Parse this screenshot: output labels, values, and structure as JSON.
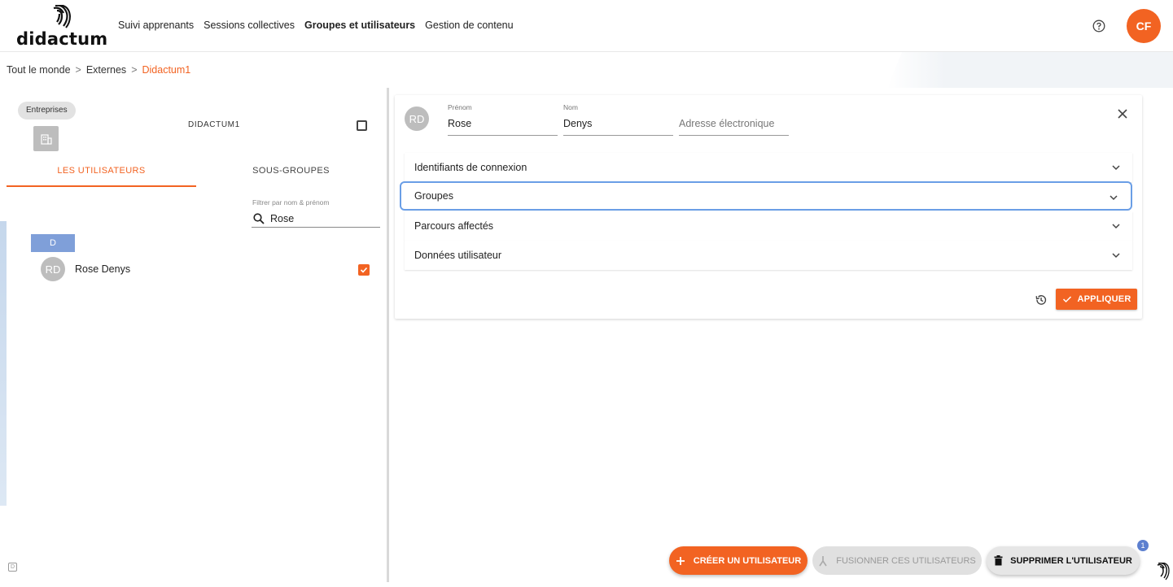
{
  "app": {
    "logo_text": "didactum",
    "nav": [
      "Suivi apprenants",
      "Sessions collectives",
      "Groupes et utilisateurs",
      "Gestion de contenu"
    ],
    "active_nav": "Groupes et utilisateurs",
    "user_initials": "CF",
    "help_icon": "help-circle-icon"
  },
  "breadcrumb": {
    "items": [
      "Tout le monde",
      "Externes"
    ],
    "separator": ">",
    "current": "Didactum1"
  },
  "left_panel": {
    "chip_label": "Entreprises",
    "company_name": "DIDACTUM1",
    "tabs": {
      "users": "LES UTILISATEURS",
      "subgroups": "SOUS-GROUPES"
    },
    "filter": {
      "label": "Filtrer par nom & prénom",
      "value": "Rose"
    },
    "letter_group": "D",
    "users": [
      {
        "initials": "RD",
        "name": "Rose Denys",
        "checked": true
      }
    ],
    "corner_badge": "D"
  },
  "user_card": {
    "initials": "RD",
    "first_name": {
      "label": "Prénom",
      "value": "Rose"
    },
    "last_name": {
      "label": "Nom",
      "value": "Denys"
    },
    "email": {
      "placeholder": "Adresse électronique",
      "value": ""
    },
    "sections": [
      "Identifiants de connexion",
      "Groupes",
      "Parcours affectés",
      "Données utilisateur"
    ],
    "focused_section": "Groupes",
    "apply_label": "APPLIQUER"
  },
  "actions": {
    "create_label": "CRÉER UN UTILISATEUR",
    "merge_label": "FUSIONNER CES UTILISATEURS",
    "delete_label": "SUPPRIMER L'UTILISATEUR",
    "badge_count": "1"
  },
  "colors": {
    "accent": "#f26322",
    "letter_header": "#7f9fd9",
    "focus_ring": "#6a9ee6",
    "badge": "#5c7fcf"
  }
}
